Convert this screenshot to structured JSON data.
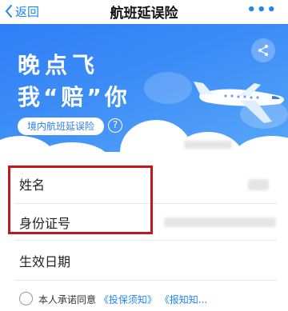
{
  "nav": {
    "back_label": "返回",
    "title": "航班延误险",
    "more_label": "•••"
  },
  "hero": {
    "slogan_line1": "晚点飞",
    "slogan_line2": "我“赔”你",
    "tag_label": "境内航班延误险",
    "help_label": "?"
  },
  "form": {
    "name_label": "姓名",
    "id_label": "身份证号",
    "date_label": "生效日期"
  },
  "agreement": {
    "prefix": "本人承诺同意",
    "link1": "《投保须知》",
    "link2": "《报知知..."
  },
  "colors": {
    "accent": "#1f86f0",
    "banner": "#2f7ef6",
    "highlight": "#c0181c"
  }
}
